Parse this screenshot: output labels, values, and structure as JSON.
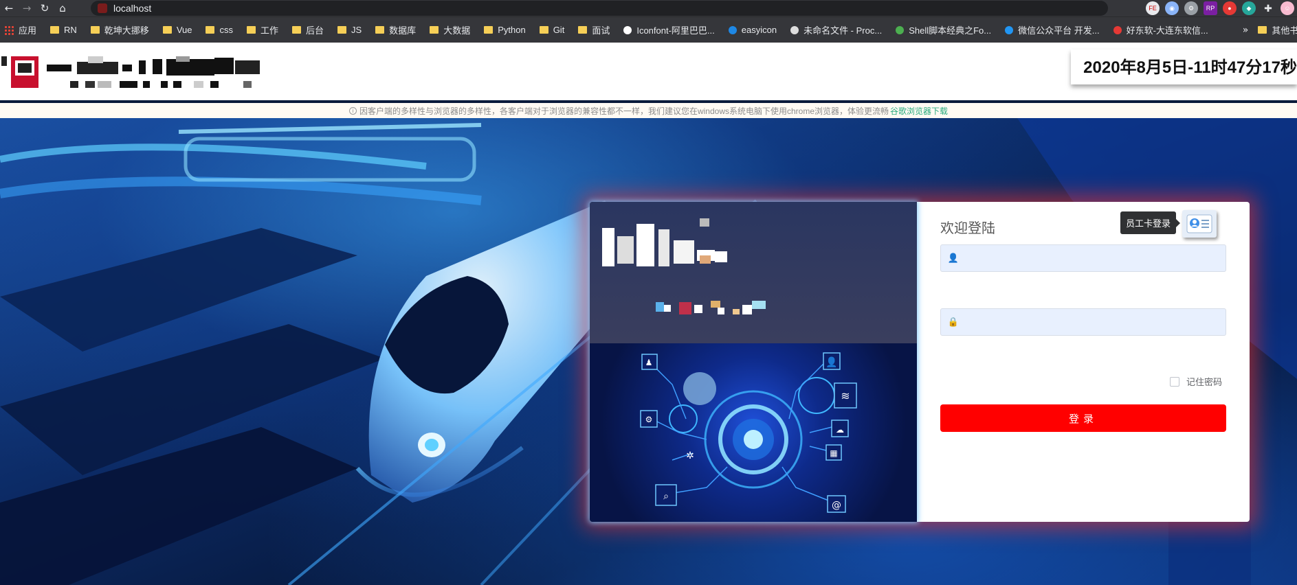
{
  "browser": {
    "url": "localhost",
    "nav": {
      "back": "←",
      "forward": "→",
      "reload": "↻",
      "home": "⌂"
    },
    "bookmarks": [
      {
        "label": "应用",
        "icon": "apps-grid-icon"
      },
      {
        "label": "RN",
        "icon": "folder-icon"
      },
      {
        "label": "乾坤大挪移",
        "icon": "folder-icon"
      },
      {
        "label": "Vue",
        "icon": "folder-icon"
      },
      {
        "label": "css",
        "icon": "folder-icon"
      },
      {
        "label": "工作",
        "icon": "folder-icon"
      },
      {
        "label": "后台",
        "icon": "folder-icon"
      },
      {
        "label": "JS",
        "icon": "folder-icon"
      },
      {
        "label": "数据库",
        "icon": "folder-icon"
      },
      {
        "label": "大数据",
        "icon": "folder-icon"
      },
      {
        "label": "Python",
        "icon": "folder-icon"
      },
      {
        "label": "Git",
        "icon": "folder-icon"
      },
      {
        "label": "面试",
        "icon": "folder-icon"
      },
      {
        "label": "Iconfont-阿里巴巴...",
        "icon": "iconfont-icon"
      },
      {
        "label": "easyicon",
        "icon": "easyicon-icon"
      },
      {
        "label": "未命名文件 - Proc...",
        "icon": "processon-icon"
      },
      {
        "label": "Shell脚本经典之Fo...",
        "icon": "linux-penguin-icon"
      },
      {
        "label": "微信公众平台 开发...",
        "icon": "wechat-dev-icon"
      },
      {
        "label": "好东软-大连东软信...",
        "icon": "neusoft-icon"
      }
    ],
    "more_chevron": "»",
    "other_bookmarks": "其他书"
  },
  "header": {
    "datetime": "2020年8月5日-11时47分17秒"
  },
  "notice": {
    "info_symbol": "i",
    "text": "因客户端的多样性与浏览器的多样性，各客户端对于浏览器的兼容性都不一样，我们建议您在windows系统电脑下使用chrome浏览器，体验更流畅",
    "link": "谷歌浏览器下载"
  },
  "login": {
    "title": "欢迎登陆",
    "badge_tooltip": "员工卡登录",
    "username_placeholder": "",
    "password_placeholder": "",
    "remember_label": "记住密码",
    "submit_label": "登录"
  },
  "colors": {
    "accent_red": "#ff0000",
    "link_green": "#2bab7f",
    "input_bg": "#e8f0fe"
  }
}
